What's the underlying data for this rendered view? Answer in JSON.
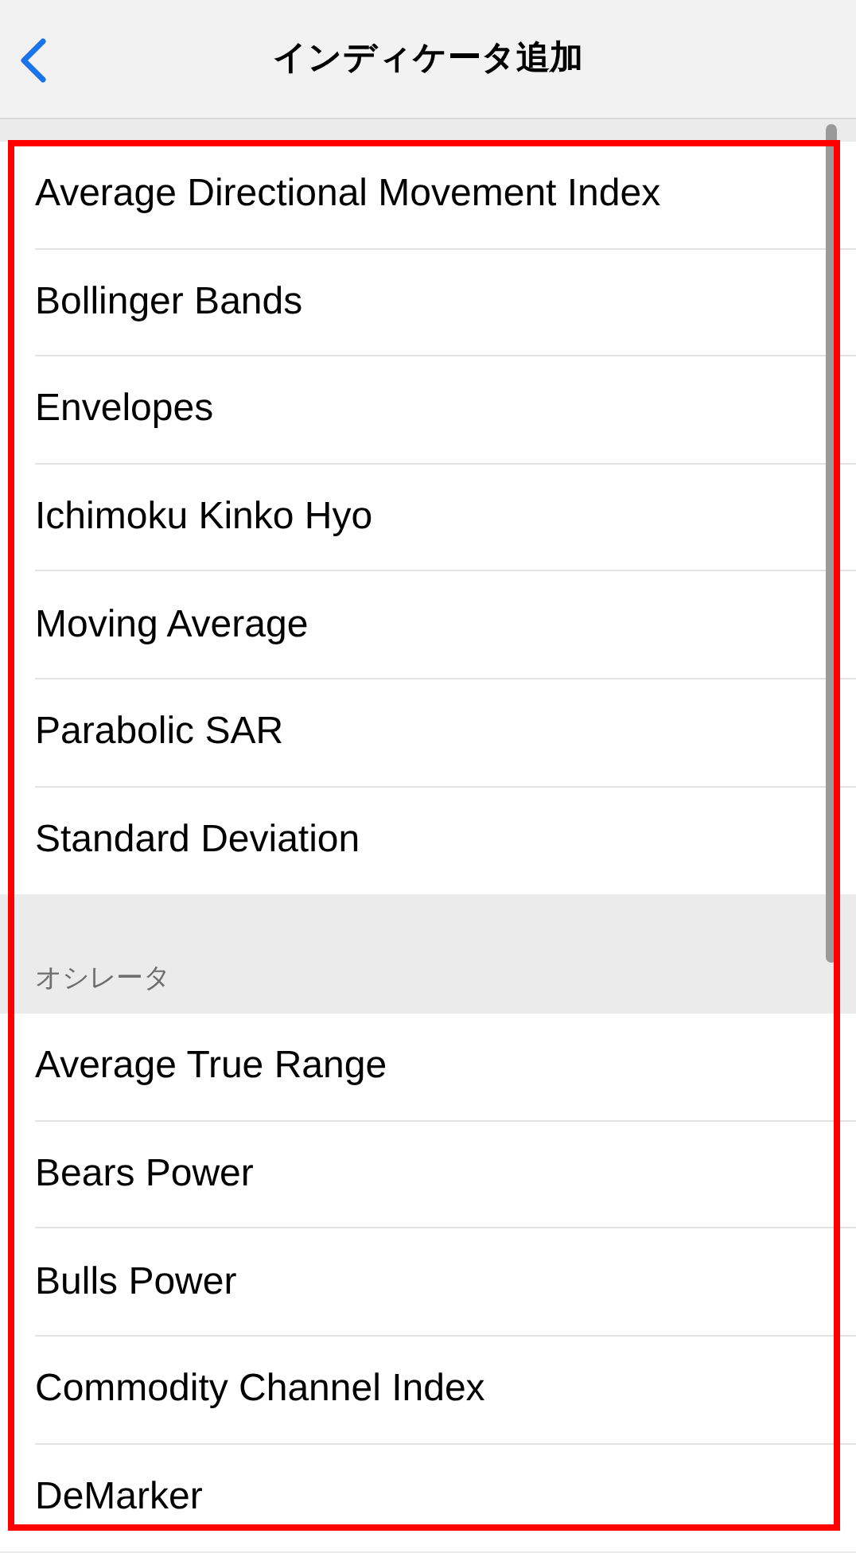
{
  "header": {
    "title": "インディケータ追加"
  },
  "sections": [
    {
      "items": [
        "Average Directional Movement Index",
        "Bollinger Bands",
        "Envelopes",
        "Ichimoku Kinko Hyo",
        "Moving Average",
        "Parabolic SAR",
        "Standard Deviation"
      ]
    },
    {
      "title": "オシレータ",
      "items": [
        "Average True Range",
        "Bears Power",
        "Bulls Power",
        "Commodity Channel Index",
        "DeMarker"
      ]
    }
  ]
}
